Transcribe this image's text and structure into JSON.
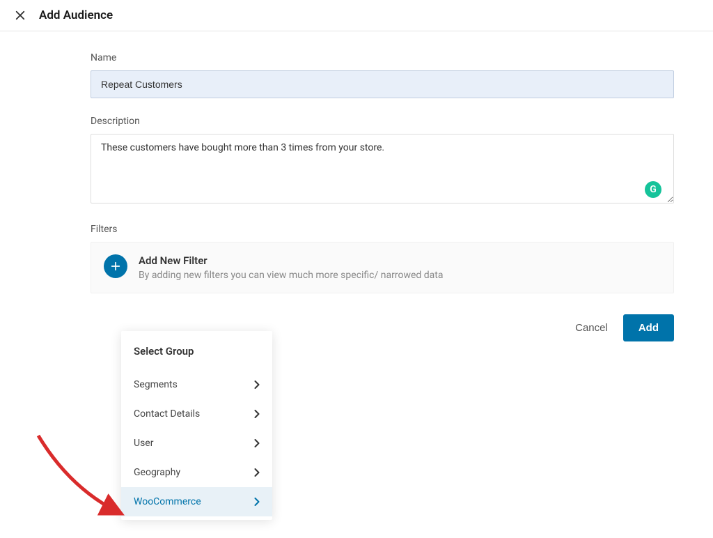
{
  "header": {
    "title": "Add Audience"
  },
  "form": {
    "name_label": "Name",
    "name_value": "Repeat Customers",
    "description_label": "Description",
    "description_value": "These customers have bought more than 3 times from your store.",
    "filters_label": "Filters",
    "filter_box": {
      "title": "Add New Filter",
      "subtitle": "By adding new filters you can view much more specific/ narrowed data"
    }
  },
  "actions": {
    "cancel": "Cancel",
    "add": "Add"
  },
  "dropdown": {
    "title": "Select Group",
    "items": [
      {
        "label": "Segments",
        "highlighted": false
      },
      {
        "label": "Contact Details",
        "highlighted": false
      },
      {
        "label": "User",
        "highlighted": false
      },
      {
        "label": "Geography",
        "highlighted": false
      },
      {
        "label": "WooCommerce",
        "highlighted": true
      }
    ]
  },
  "grammarly_badge": "G",
  "colors": {
    "primary": "#0073aa",
    "input_bg": "#e8eff9",
    "highlight_bg": "#e8f1f7",
    "grammarly": "#15c39a",
    "arrow": "#d92b2b"
  }
}
